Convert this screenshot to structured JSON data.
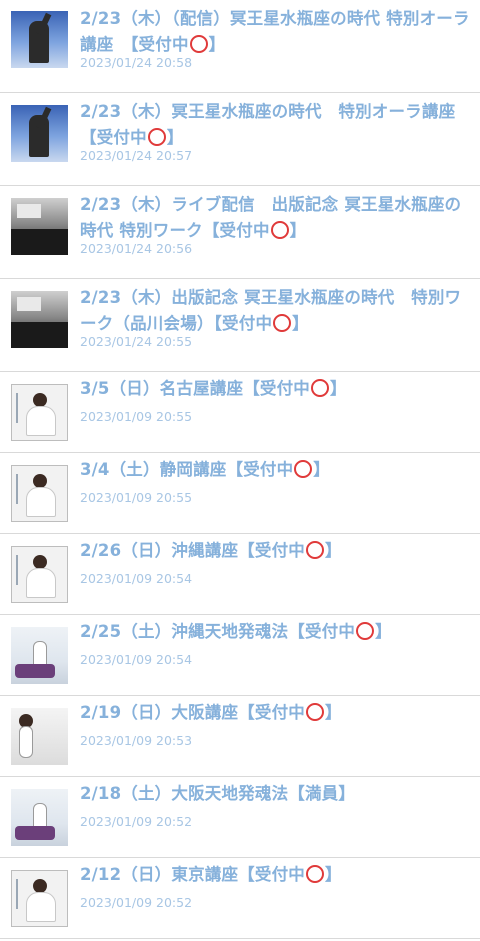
{
  "items": [
    {
      "title_before": "2/23（木）（配信）冥王星水瓶座の時代 特別オーラ講座　【受付中",
      "title_after": "】",
      "has_circle": true,
      "date": "2023/01/24 20:58",
      "thumb": "statue-sky-icon"
    },
    {
      "title_before": "2/23（木）冥王星水瓶座の時代　特別オーラ講座【受付中",
      "title_after": "】",
      "has_circle": true,
      "date": "2023/01/24 20:57",
      "thumb": "statue-sky-icon"
    },
    {
      "title_before": "2/23（木）ライブ配信　出版記念 冥王星水瓶座の時代 特別ワーク【受付中",
      "title_after": "】",
      "has_circle": true,
      "date": "2023/01/24 20:56",
      "thumb": "lecture-hall-icon"
    },
    {
      "title_before": "2/23（木）出版記念 冥王星水瓶座の時代　特別ワーク（品川会場）【受付中",
      "title_after": "】",
      "has_circle": true,
      "date": "2023/01/24 20:55",
      "thumb": "lecture-hall-icon"
    },
    {
      "title_before": "3/5（日）名古屋講座【受付中",
      "title_after": "】",
      "has_circle": true,
      "date": "2023/01/09 20:55",
      "thumb": "speaker-portrait-icon"
    },
    {
      "title_before": "3/4（土）静岡講座【受付中",
      "title_after": "】",
      "has_circle": true,
      "date": "2023/01/09 20:55",
      "thumb": "speaker-portrait-icon"
    },
    {
      "title_before": "2/26（日）沖縄講座【受付中",
      "title_after": "】",
      "has_circle": true,
      "date": "2023/01/09 20:54",
      "thumb": "speaker-portrait-icon"
    },
    {
      "title_before": "2/25（土）沖縄天地発魂法【受付中",
      "title_after": "】",
      "has_circle": true,
      "date": "2023/01/09 20:54",
      "thumb": "healing-room-icon"
    },
    {
      "title_before": "2/19（日）大阪講座【受付中",
      "title_after": "】",
      "has_circle": true,
      "date": "2023/01/09 20:53",
      "thumb": "classroom-speaker-icon"
    },
    {
      "title_before": "2/18（土）大阪天地発魂法【満員】",
      "title_after": "",
      "has_circle": false,
      "date": "2023/01/09 20:52",
      "thumb": "healing-room-icon"
    },
    {
      "title_before": "2/12（日）東京講座【受付中",
      "title_after": "】",
      "has_circle": true,
      "date": "2023/01/09 20:52",
      "thumb": "speaker-portrait-icon"
    }
  ],
  "colors": {
    "title": "#86b1db",
    "date": "#a8c6e4",
    "circle": "#e03a3a",
    "divider": "#d9d9d9"
  }
}
